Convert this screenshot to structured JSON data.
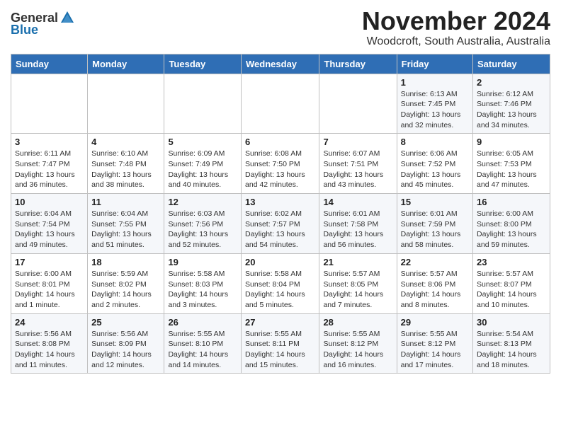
{
  "logo": {
    "general": "General",
    "blue": "Blue"
  },
  "title": "November 2024",
  "subtitle": "Woodcroft, South Australia, Australia",
  "days_of_week": [
    "Sunday",
    "Monday",
    "Tuesday",
    "Wednesday",
    "Thursday",
    "Friday",
    "Saturday"
  ],
  "weeks": [
    [
      {
        "day": "",
        "info": ""
      },
      {
        "day": "",
        "info": ""
      },
      {
        "day": "",
        "info": ""
      },
      {
        "day": "",
        "info": ""
      },
      {
        "day": "",
        "info": ""
      },
      {
        "day": "1",
        "info": "Sunrise: 6:13 AM\nSunset: 7:45 PM\nDaylight: 13 hours and 32 minutes."
      },
      {
        "day": "2",
        "info": "Sunrise: 6:12 AM\nSunset: 7:46 PM\nDaylight: 13 hours and 34 minutes."
      }
    ],
    [
      {
        "day": "3",
        "info": "Sunrise: 6:11 AM\nSunset: 7:47 PM\nDaylight: 13 hours and 36 minutes."
      },
      {
        "day": "4",
        "info": "Sunrise: 6:10 AM\nSunset: 7:48 PM\nDaylight: 13 hours and 38 minutes."
      },
      {
        "day": "5",
        "info": "Sunrise: 6:09 AM\nSunset: 7:49 PM\nDaylight: 13 hours and 40 minutes."
      },
      {
        "day": "6",
        "info": "Sunrise: 6:08 AM\nSunset: 7:50 PM\nDaylight: 13 hours and 42 minutes."
      },
      {
        "day": "7",
        "info": "Sunrise: 6:07 AM\nSunset: 7:51 PM\nDaylight: 13 hours and 43 minutes."
      },
      {
        "day": "8",
        "info": "Sunrise: 6:06 AM\nSunset: 7:52 PM\nDaylight: 13 hours and 45 minutes."
      },
      {
        "day": "9",
        "info": "Sunrise: 6:05 AM\nSunset: 7:53 PM\nDaylight: 13 hours and 47 minutes."
      }
    ],
    [
      {
        "day": "10",
        "info": "Sunrise: 6:04 AM\nSunset: 7:54 PM\nDaylight: 13 hours and 49 minutes."
      },
      {
        "day": "11",
        "info": "Sunrise: 6:04 AM\nSunset: 7:55 PM\nDaylight: 13 hours and 51 minutes."
      },
      {
        "day": "12",
        "info": "Sunrise: 6:03 AM\nSunset: 7:56 PM\nDaylight: 13 hours and 52 minutes."
      },
      {
        "day": "13",
        "info": "Sunrise: 6:02 AM\nSunset: 7:57 PM\nDaylight: 13 hours and 54 minutes."
      },
      {
        "day": "14",
        "info": "Sunrise: 6:01 AM\nSunset: 7:58 PM\nDaylight: 13 hours and 56 minutes."
      },
      {
        "day": "15",
        "info": "Sunrise: 6:01 AM\nSunset: 7:59 PM\nDaylight: 13 hours and 58 minutes."
      },
      {
        "day": "16",
        "info": "Sunrise: 6:00 AM\nSunset: 8:00 PM\nDaylight: 13 hours and 59 minutes."
      }
    ],
    [
      {
        "day": "17",
        "info": "Sunrise: 6:00 AM\nSunset: 8:01 PM\nDaylight: 14 hours and 1 minute."
      },
      {
        "day": "18",
        "info": "Sunrise: 5:59 AM\nSunset: 8:02 PM\nDaylight: 14 hours and 2 minutes."
      },
      {
        "day": "19",
        "info": "Sunrise: 5:58 AM\nSunset: 8:03 PM\nDaylight: 14 hours and 3 minutes."
      },
      {
        "day": "20",
        "info": "Sunrise: 5:58 AM\nSunset: 8:04 PM\nDaylight: 14 hours and 5 minutes."
      },
      {
        "day": "21",
        "info": "Sunrise: 5:57 AM\nSunset: 8:05 PM\nDaylight: 14 hours and 7 minutes."
      },
      {
        "day": "22",
        "info": "Sunrise: 5:57 AM\nSunset: 8:06 PM\nDaylight: 14 hours and 8 minutes."
      },
      {
        "day": "23",
        "info": "Sunrise: 5:57 AM\nSunset: 8:07 PM\nDaylight: 14 hours and 10 minutes."
      }
    ],
    [
      {
        "day": "24",
        "info": "Sunrise: 5:56 AM\nSunset: 8:08 PM\nDaylight: 14 hours and 11 minutes."
      },
      {
        "day": "25",
        "info": "Sunrise: 5:56 AM\nSunset: 8:09 PM\nDaylight: 14 hours and 12 minutes."
      },
      {
        "day": "26",
        "info": "Sunrise: 5:55 AM\nSunset: 8:10 PM\nDaylight: 14 hours and 14 minutes."
      },
      {
        "day": "27",
        "info": "Sunrise: 5:55 AM\nSunset: 8:11 PM\nDaylight: 14 hours and 15 minutes."
      },
      {
        "day": "28",
        "info": "Sunrise: 5:55 AM\nSunset: 8:12 PM\nDaylight: 14 hours and 16 minutes."
      },
      {
        "day": "29",
        "info": "Sunrise: 5:55 AM\nSunset: 8:12 PM\nDaylight: 14 hours and 17 minutes."
      },
      {
        "day": "30",
        "info": "Sunrise: 5:54 AM\nSunset: 8:13 PM\nDaylight: 14 hours and 18 minutes."
      }
    ]
  ]
}
